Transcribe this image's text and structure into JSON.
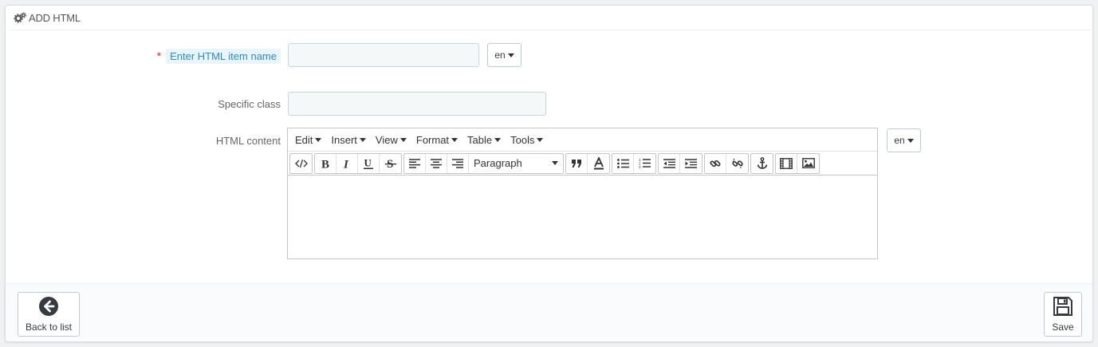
{
  "panel": {
    "title": "ADD HTML",
    "title_icon": "cogs-icon"
  },
  "form": {
    "name_field": {
      "required_mark": "*",
      "label": "Enter HTML item name",
      "value": "",
      "lang": "en"
    },
    "class_field": {
      "label": "Specific class",
      "value": ""
    },
    "content_field": {
      "label": "HTML content",
      "lang": "en"
    }
  },
  "editor": {
    "menus": [
      "Edit",
      "Insert",
      "View",
      "Format",
      "Table",
      "Tools"
    ],
    "format_select": "Paragraph",
    "toolbar_icons": [
      "source-code-icon",
      "bold-icon",
      "italic-icon",
      "underline-icon",
      "strikethrough-icon",
      "align-left-icon",
      "align-center-icon",
      "align-right-icon",
      "blockquote-icon",
      "text-color-icon",
      "bullet-list-icon",
      "numbered-list-icon",
      "outdent-icon",
      "indent-icon",
      "link-icon",
      "unlink-icon",
      "anchor-icon",
      "media-icon",
      "image-icon"
    ],
    "content": ""
  },
  "footer": {
    "back_label": "Back to list",
    "save_label": "Save"
  }
}
